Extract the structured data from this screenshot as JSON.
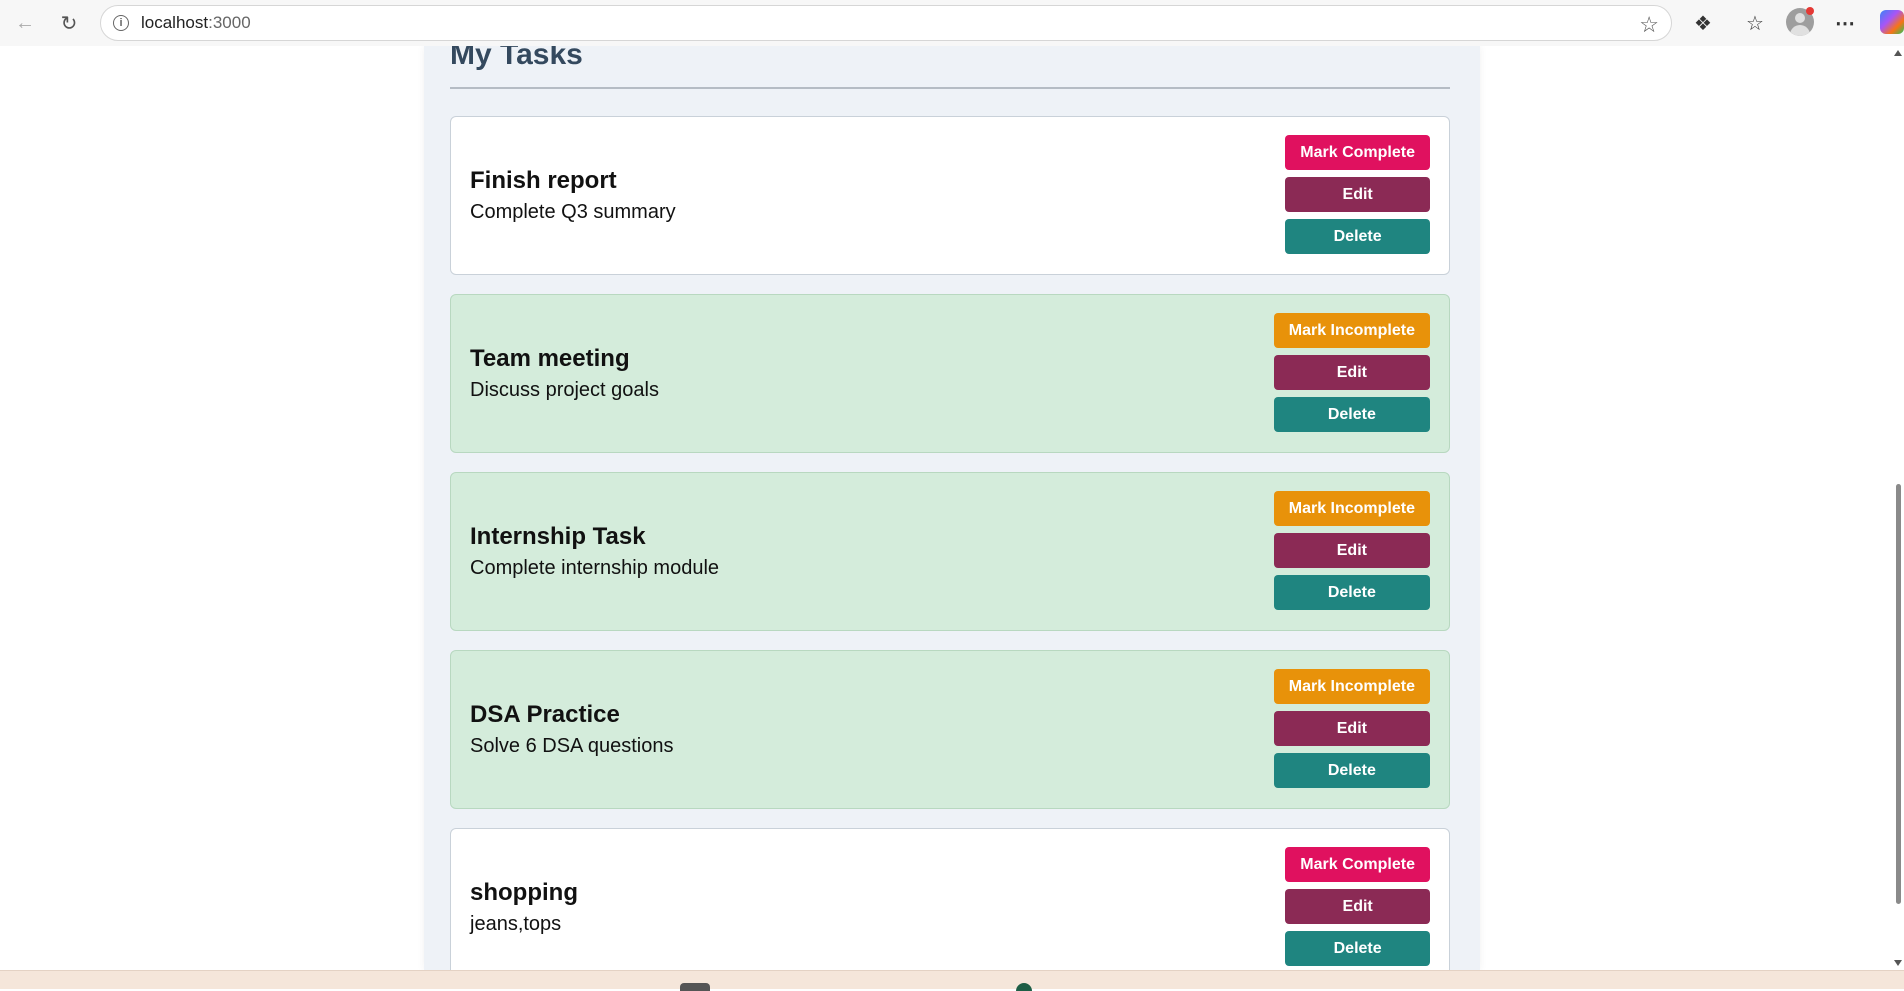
{
  "browser": {
    "url_host": "localhost",
    "url_suffix": ":3000"
  },
  "page": {
    "title": "My Tasks"
  },
  "tasks": [
    {
      "title": "Finish report",
      "description": "Complete Q3 summary",
      "completed": false,
      "toggle_label": "Mark Complete",
      "edit_label": "Edit",
      "delete_label": "Delete"
    },
    {
      "title": "Team meeting",
      "description": "Discuss project goals",
      "completed": true,
      "toggle_label": "Mark Incomplete",
      "edit_label": "Edit",
      "delete_label": "Delete"
    },
    {
      "title": "Internship Task",
      "description": "Complete internship module",
      "completed": true,
      "toggle_label": "Mark Incomplete",
      "edit_label": "Edit",
      "delete_label": "Delete"
    },
    {
      "title": "DSA Practice",
      "description": "Solve 6 DSA questions",
      "completed": true,
      "toggle_label": "Mark Incomplete",
      "edit_label": "Edit",
      "delete_label": "Delete"
    },
    {
      "title": "shopping",
      "description": "jeans,tops",
      "completed": false,
      "toggle_label": "Mark Complete",
      "edit_label": "Edit",
      "delete_label": "Delete"
    }
  ],
  "colors": {
    "mark_complete": "#e0115f",
    "mark_incomplete": "#e8920a",
    "edit": "#8b2a55",
    "delete": "#1f8580",
    "completed_card": "#d4ecdb",
    "title": "#34495e"
  },
  "icons": {
    "back": "arrow-left-icon",
    "reload": "reload-icon",
    "info": "info-icon",
    "favorite": "star-icon",
    "extensions": "puzzle-icon",
    "favorites": "favorites-icon",
    "profile": "avatar",
    "menu": "more-icon",
    "copilot": "copilot-icon"
  }
}
